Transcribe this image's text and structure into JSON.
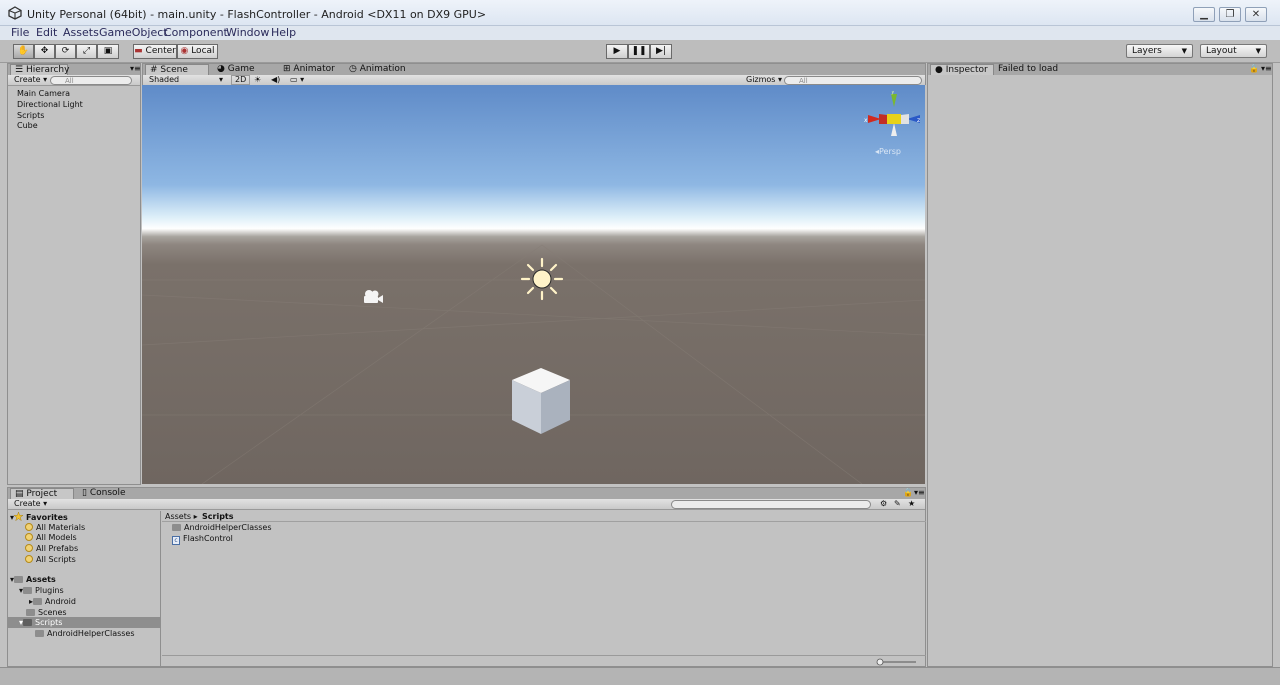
{
  "window": {
    "title": "Unity Personal (64bit) - main.unity - FlashController - Android <DX11 on DX9 GPU>",
    "controls": [
      "▁",
      "❐",
      "✕"
    ]
  },
  "menubar": {
    "items": [
      "File",
      "Edit",
      "Assets",
      "GameObject",
      "Component",
      "Window",
      "Help"
    ]
  },
  "toolbar": {
    "transform_tools": [
      "hand-tool",
      "move-tool",
      "rotate-tool",
      "scale-tool",
      "rect-tool"
    ],
    "pivot_label": "Center",
    "space_label": "Local",
    "layers_label": "Layers",
    "layout_label": "Layout"
  },
  "hierarchy": {
    "tab_label": "Hierarchy",
    "create_label": "Create",
    "search_placeholder": "All",
    "items": [
      "Main Camera",
      "Directional Light",
      "Scripts",
      "Cube"
    ]
  },
  "scene": {
    "tabs": [
      {
        "label": "Scene",
        "active": true
      },
      {
        "label": "Game",
        "active": false
      },
      {
        "label": "Animator",
        "active": false
      },
      {
        "label": "Animation",
        "active": false
      }
    ],
    "shading_label": "Shaded",
    "mode_2d_label": "2D",
    "gizmos_label": "Gizmos",
    "search_placeholder": "All",
    "persp_label": "Persp",
    "gizmo_axes": {
      "x": "x",
      "y": "y",
      "z": "z"
    },
    "colors": {
      "x_axis": "#d12a1f",
      "y_axis": "#7ab830",
      "z_axis": "#2a59c7",
      "center": "#e8d21a"
    }
  },
  "inspector": {
    "tab_label": "Inspector",
    "message": "Failed to load"
  },
  "project": {
    "tabs": [
      {
        "label": "Project",
        "active": true
      },
      {
        "label": "Console",
        "active": false
      }
    ],
    "create_label": "Create",
    "favorites": {
      "title": "Favorites",
      "items": [
        "All Materials",
        "All Models",
        "All Prefabs",
        "All Scripts"
      ]
    },
    "assets_tree": {
      "root": "Assets",
      "items": [
        {
          "label": "Plugins",
          "depth": 1,
          "expanded": true
        },
        {
          "label": "Android",
          "depth": 2,
          "expanded": false
        },
        {
          "label": "Scenes",
          "depth": 1,
          "expanded": false
        },
        {
          "label": "Scripts",
          "depth": 1,
          "expanded": true,
          "selected": true
        },
        {
          "label": "AndroidHelperClasses",
          "depth": 2,
          "expanded": false
        }
      ]
    },
    "breadcrumb": [
      "Assets",
      "Scripts"
    ],
    "files": [
      {
        "label": "AndroidHelperClasses",
        "kind": "folder"
      },
      {
        "label": "FlashControl",
        "kind": "script"
      }
    ]
  }
}
